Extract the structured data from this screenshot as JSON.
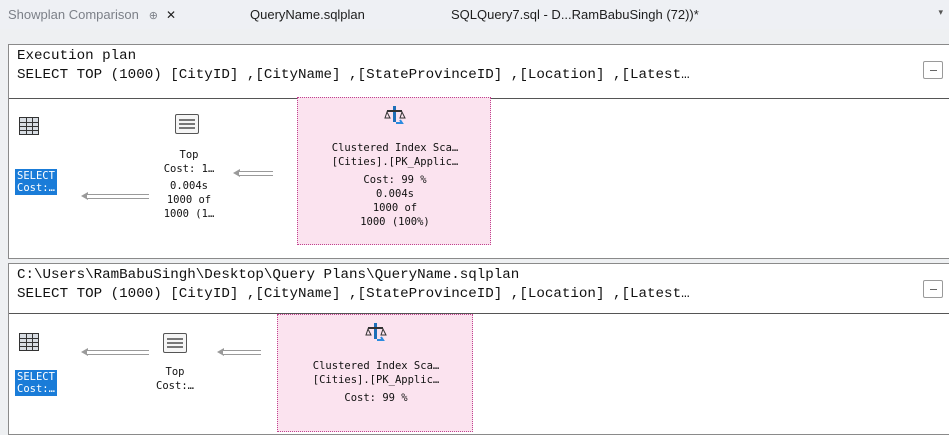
{
  "tabs": [
    {
      "label": "Showplan Comparison",
      "pin": "⊕",
      "close": "✕"
    },
    {
      "label": "QueryName.sqlplan"
    },
    {
      "label": "SQLQuery7.sql - D...RamBabuSingh (72))*"
    }
  ],
  "dropdown_glyph": "▾",
  "panels": [
    {
      "title": "Execution plan",
      "query": "SELECT TOP (1000) [CityID] ,[CityName] ,[StateProvinceID] ,[Location] ,[Latest…",
      "select": {
        "line1": "SELECT",
        "line2": "Cost:…"
      },
      "top": {
        "name": "Top",
        "cost": "Cost: 1…",
        "time": "0.004s",
        "rows": "1000 of",
        "rows2": "1000 (1…"
      },
      "scan": {
        "name": "Clustered Index Sca…",
        "object": "[Cities].[PK_Applic…",
        "cost": "Cost: 99 %",
        "time": "0.004s",
        "rows": "1000 of",
        "rows2": "1000 (100%)"
      }
    },
    {
      "title": "C:\\Users\\RamBabuSingh\\Desktop\\Query Plans\\QueryName.sqlplan",
      "query": "SELECT TOP (1000) [CityID] ,[CityName] ,[StateProvinceID] ,[Location] ,[Latest…",
      "select": {
        "line1": "SELECT",
        "line2": "Cost:…"
      },
      "top": {
        "name": "Top",
        "cost": "Cost:…"
      },
      "scan": {
        "name": "Clustered Index Sca…",
        "object": "[Cities].[PK_Applic…",
        "cost": "Cost: 99 %"
      }
    }
  ],
  "colors": {
    "selection": "#1a7cd8",
    "compare_highlight": "#fbe3ef",
    "compare_border": "#c1428f"
  }
}
